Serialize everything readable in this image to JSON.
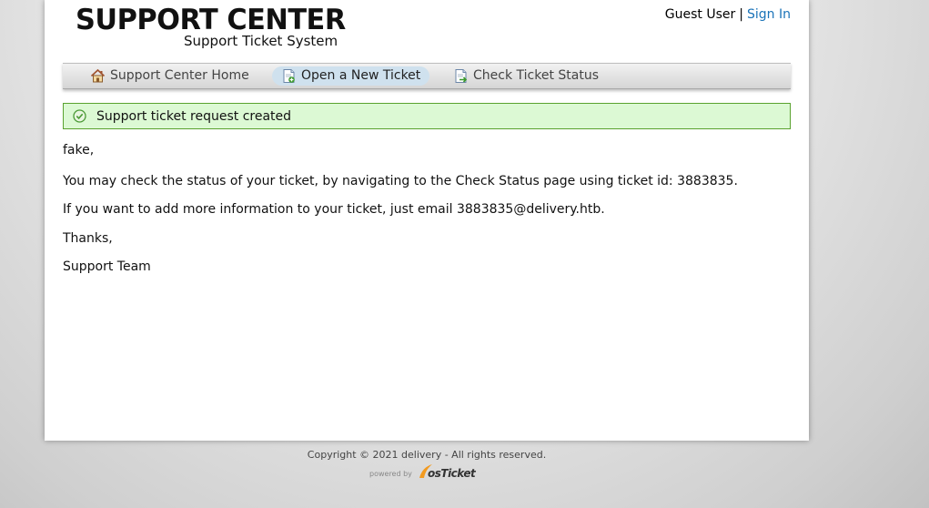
{
  "header": {
    "logo_title": "SUPPORT CENTER",
    "logo_subtitle": "Support Ticket System",
    "user_label": "Guest User",
    "separator": "|",
    "sign_in_label": "Sign In"
  },
  "nav": {
    "items": [
      {
        "label": "Support Center Home",
        "icon": "home-icon",
        "active": false
      },
      {
        "label": "Open a New Ticket",
        "icon": "new-ticket-icon",
        "active": true
      },
      {
        "label": "Check Ticket Status",
        "icon": "ticket-status-icon",
        "active": false
      }
    ]
  },
  "notice": {
    "icon": "success-check-icon",
    "text": "Support ticket request created"
  },
  "message": {
    "greeting": "fake,",
    "line1": "You may check the status of your ticket, by navigating to the Check Status page using ticket id: 3883835.",
    "line2": "If you want to add more information to your ticket, just email 3883835@delivery.htb.",
    "thanks": "Thanks,",
    "signature": "Support Team"
  },
  "footer": {
    "copyright": "Copyright © 2021 delivery - All rights reserved.",
    "powered_by": "powered by",
    "powered_brand": "osTicket"
  },
  "colors": {
    "link": "#1a73b8",
    "notice_bg": "#dcf9d4",
    "notice_border": "#5aa22f",
    "active_tab": "#cfe1ee"
  }
}
